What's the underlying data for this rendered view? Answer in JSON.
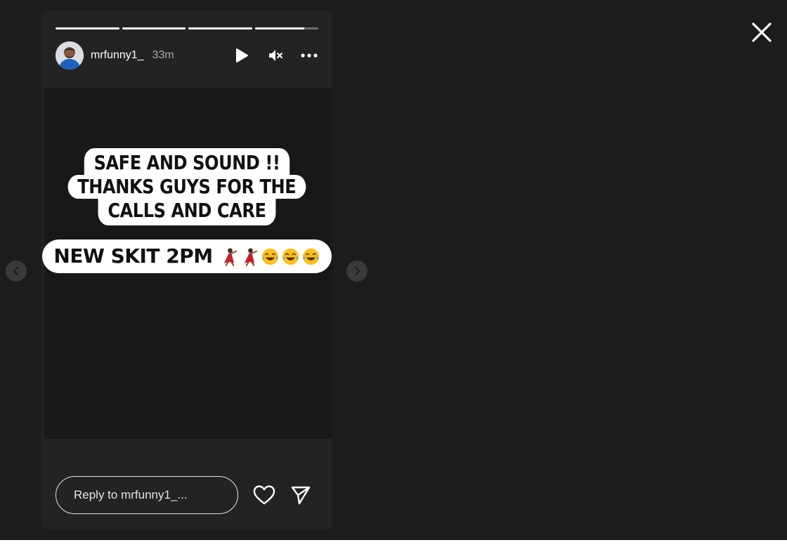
{
  "story": {
    "username": "mrfunny1_",
    "timestamp": "33m",
    "progress_segments": [
      1.0,
      1.0,
      1.0,
      0.78
    ]
  },
  "stickers": {
    "block_lines": [
      "SAFE AND SOUND !!",
      "THANKS GUYS FOR THE",
      "CALLS AND CARE"
    ],
    "single_line_text": "NEW SKIT 2PM",
    "single_line_emoji": [
      "dancer-emoji",
      "dancer-emoji",
      "tears-of-joy-emoji",
      "tears-of-joy-emoji",
      "tears-of-joy-emoji"
    ]
  },
  "reply": {
    "placeholder": "Reply to mrfunny1_..."
  },
  "icons": {
    "close": "close-icon",
    "play": "play-icon",
    "mute": "muted-speaker-icon",
    "more": "more-options-icon",
    "like": "heart-icon",
    "share": "send-icon",
    "prev": "chevron-left-icon",
    "next": "chevron-right-icon"
  },
  "colors": {
    "background": "#1c1c1c",
    "card": "#232323",
    "media": "#181818",
    "text": "#ffffff",
    "muted_text": "#a8a8a8"
  }
}
